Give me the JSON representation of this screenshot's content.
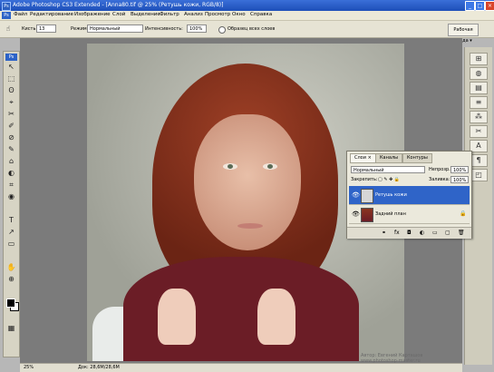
{
  "window": {
    "title": "Adobe Photoshop CS3 Extended - [Anna80.tif @ 25% (Ретушь кожи, RGB/8)]",
    "app_badge": "Ps",
    "minimize": "_",
    "maximize": "□",
    "close": "×"
  },
  "menubar": {
    "items": [
      "Файл",
      "Редактирование",
      "Изображение",
      "Слой",
      "Выделение",
      "Фильтр",
      "Анализ",
      "Просмотр",
      "Окно",
      "Справка"
    ]
  },
  "options_bar": {
    "tool_label": "Кисть:",
    "brush_size": "13",
    "mode_label": "Режим:",
    "mode_value": "Нормальный",
    "strength_label": "Интенсивность:",
    "strength_value": "100%",
    "sample_all_label": "Образец всех слоев",
    "workspace_label": "Рабочая среда ▾"
  },
  "toolbox": {
    "badge": "Ps",
    "tools": [
      "↖",
      "⬚",
      "ʘ",
      "⌖",
      "✂",
      "✐",
      "⊘",
      "✎",
      "⌂",
      "◐",
      "⌗",
      "◉",
      "T",
      "↗",
      "▭",
      "✋",
      "⊕",
      "▦"
    ]
  },
  "dock": {
    "buttons": [
      "⊞",
      "◍",
      "▤",
      "≡",
      "⁂",
      "✂",
      "A",
      "¶",
      "◰",
      "⊞"
    ]
  },
  "layers_panel": {
    "tabs": [
      "Слои ×",
      "Каналы",
      "Контуры"
    ],
    "blend_mode": "Нормальный",
    "opacity_label": "Непрозр.:",
    "opacity_value": "100%",
    "lock_label": "Закрепить:",
    "fill_label": "Заливка:",
    "fill_value": "100%",
    "layers": [
      {
        "name": "Ретушь кожи",
        "selected": true
      },
      {
        "name": "Задний план",
        "selected": false
      }
    ],
    "bottom_icons": [
      "⚭",
      "fx",
      "◘",
      "◐",
      "▭",
      "▢",
      "🗑"
    ]
  },
  "statusbar": {
    "zoom": "25%",
    "doc_info": "Док: 28,6M/28,6M"
  },
  "watermark": {
    "line1": "Автор: Евгений Карташов",
    "line2": "www.photoshop-master.ru"
  },
  "colors": {
    "titlebar": "#1d4fb8",
    "selected_layer": "#2f64c8",
    "sweater": "#6b1d26",
    "hair": "#8a3520"
  }
}
